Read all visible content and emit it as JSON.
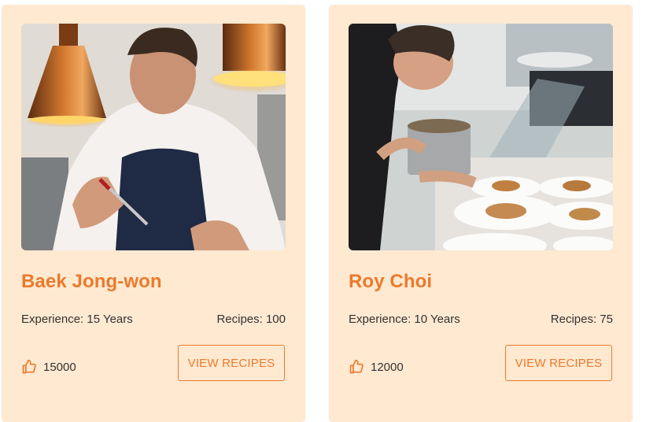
{
  "colors": {
    "card_bg": "#ffe9d1",
    "accent": "#ea7a2c",
    "text": "#333333"
  },
  "chefs": [
    {
      "name": "Baek Jong-won",
      "experience": "Experience: 15 Years",
      "recipes": "Recipes: 100",
      "likes": "15000",
      "button_label": "VIEW RECIPES",
      "like_icon": "thumbs-up-icon",
      "photo": "chef-photo-baek"
    },
    {
      "name": "Roy Choi",
      "experience": "Experience: 10 Years",
      "recipes": "Recipes: 75",
      "likes": "12000",
      "button_label": "VIEW RECIPES",
      "like_icon": "thumbs-up-icon",
      "photo": "chef-photo-roy"
    }
  ]
}
